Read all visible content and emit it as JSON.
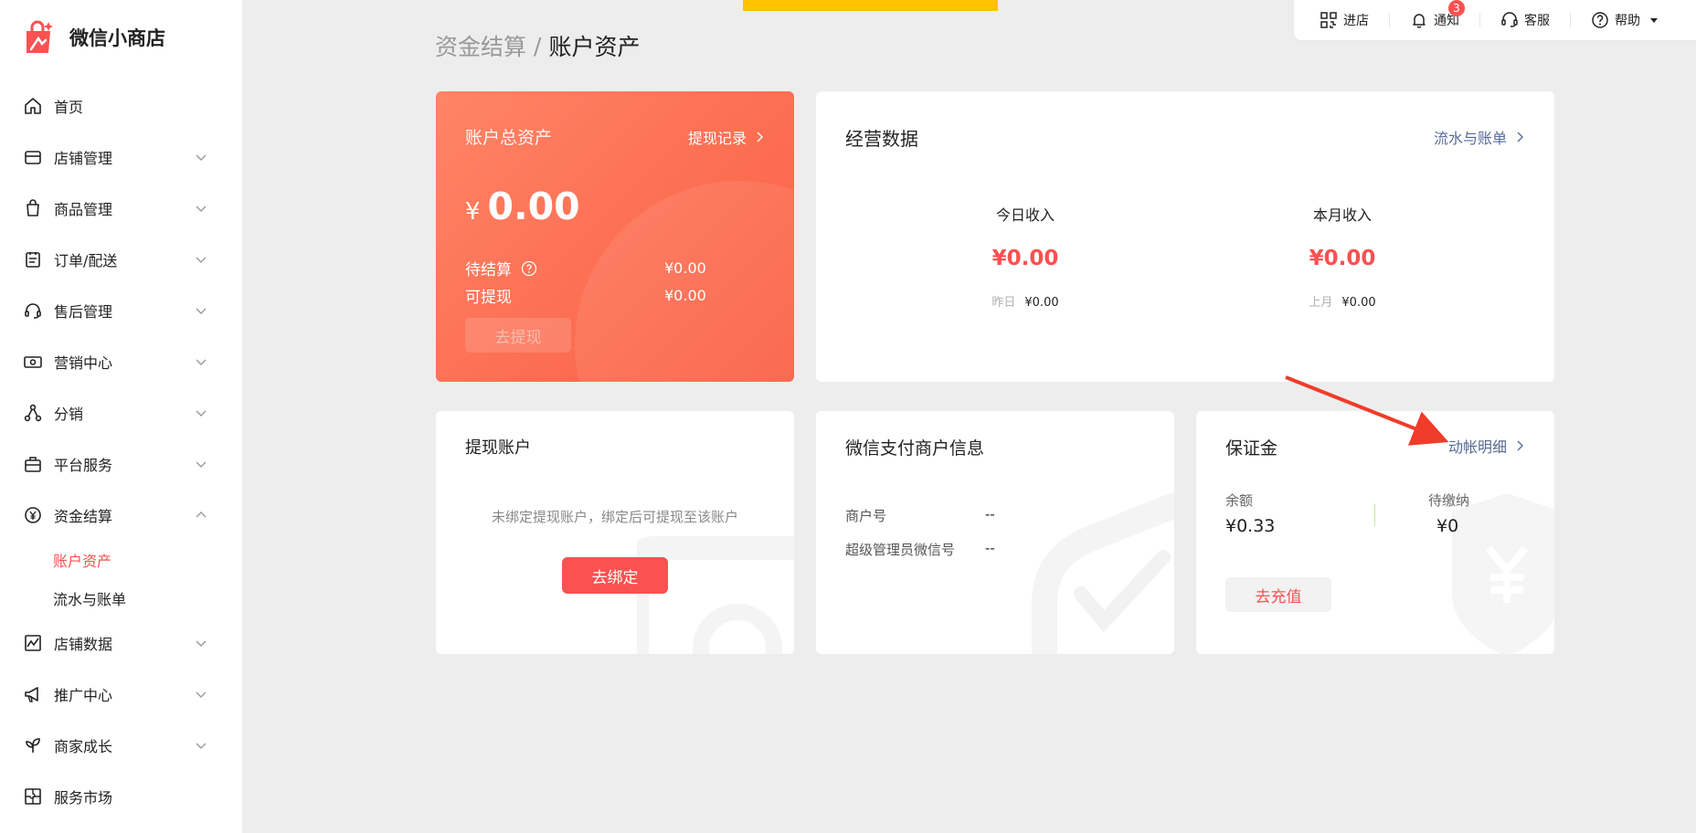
{
  "app": {
    "name": "微信小商店"
  },
  "sidebar": {
    "items": [
      {
        "label": "首页",
        "icon": "home-icon",
        "expandable": false
      },
      {
        "label": "店铺管理",
        "icon": "store-icon",
        "expandable": true
      },
      {
        "label": "商品管理",
        "icon": "shopping-bag-icon",
        "expandable": true
      },
      {
        "label": "订单/配送",
        "icon": "clipboard-icon",
        "expandable": true
      },
      {
        "label": "售后管理",
        "icon": "headset-icon",
        "expandable": true
      },
      {
        "label": "营销中心",
        "icon": "ticket-icon",
        "expandable": true
      },
      {
        "label": "分销",
        "icon": "share-nodes-icon",
        "expandable": true
      },
      {
        "label": "平台服务",
        "icon": "briefcase-icon",
        "expandable": true
      },
      {
        "label": "资金结算",
        "icon": "yuan-circle-icon",
        "expandable": true,
        "expanded": true
      },
      {
        "label": "店铺数据",
        "icon": "line-chart-icon",
        "expandable": true
      },
      {
        "label": "推广中心",
        "icon": "megaphone-icon",
        "expandable": true
      },
      {
        "label": "商家成长",
        "icon": "sprout-icon",
        "expandable": true
      },
      {
        "label": "服务市场",
        "icon": "puzzle-icon",
        "expandable": false
      }
    ],
    "sub_items": [
      {
        "label": "账户资产",
        "active": true
      },
      {
        "label": "流水与账单",
        "active": false
      }
    ]
  },
  "topbar": {
    "items": [
      {
        "label": "进店",
        "icon": "qrcode-icon"
      },
      {
        "label": "通知",
        "icon": "bell-icon",
        "badge": "3"
      },
      {
        "label": "客服",
        "icon": "headset-icon"
      },
      {
        "label": "帮助",
        "icon": "question-circle-icon"
      }
    ]
  },
  "breadcrumb": {
    "parent": "资金结算",
    "separator": "/",
    "current": "账户资产"
  },
  "asset": {
    "title": "账户总资产",
    "link": "提现记录",
    "currency": "¥",
    "amount": "0.00",
    "pending_label": "待结算",
    "pending_value": "¥0.00",
    "withdrawable_label": "可提现",
    "withdrawable_value": "¥0.00",
    "withdraw_button": "去提现"
  },
  "business": {
    "title": "经营数据",
    "link": "流水与账单",
    "today_label": "今日收入",
    "today_value": "¥0.00",
    "yesterday_label": "昨日",
    "yesterday_value": "¥0.00",
    "month_label": "本月收入",
    "month_value": "¥0.00",
    "last_month_label": "上月",
    "last_month_value": "¥0.00"
  },
  "withdraw_account": {
    "title": "提现账户",
    "empty_text": "未绑定提现账户，绑定后可提现至该账户",
    "bind_button": "去绑定"
  },
  "wechat_pay": {
    "title": "微信支付商户信息",
    "merchant_id_label": "商户号",
    "merchant_id_value": "--",
    "admin_label": "超级管理员微信号",
    "admin_value": "--"
  },
  "deposit": {
    "title": "保证金",
    "link": "动帐明细",
    "balance_label": "余额",
    "balance_value": "¥0.33",
    "due_label": "待缴纳",
    "due_value": "¥0",
    "recharge_button": "去充值"
  },
  "colors": {
    "accent": "#fa5151",
    "link": "#576b95",
    "banner": "#ffc300"
  }
}
